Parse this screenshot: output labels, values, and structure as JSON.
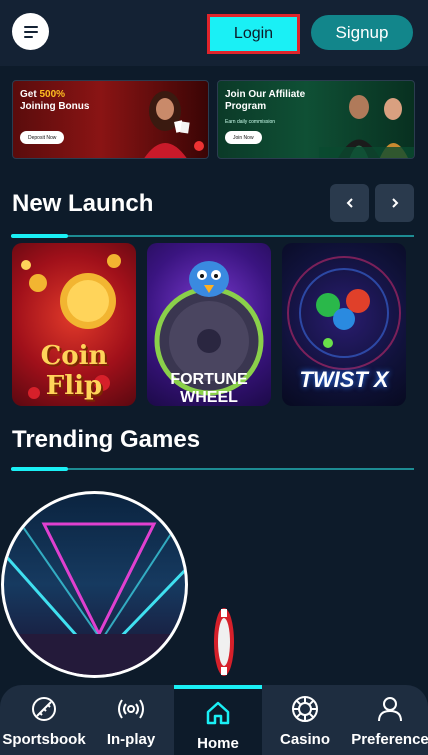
{
  "header": {
    "login_label": "Login",
    "signup_label": "Signup"
  },
  "banners": [
    {
      "title_prefix": "Get ",
      "title_highlight": "500%",
      "title_suffix": "Joining Bonus",
      "button_label": "Deposit Now"
    },
    {
      "title": "Join Our Affiliate Program",
      "subtitle": "Earn daily commission",
      "button_label": "Join Now"
    }
  ],
  "new_launch": {
    "title": "New Launch",
    "games": [
      {
        "label": "Coin Flip"
      },
      {
        "label": "FORTUNE WHEEL"
      },
      {
        "label": "TWIST X"
      }
    ]
  },
  "trending": {
    "title": "Trending Games"
  },
  "bottom_nav": [
    {
      "label": "Sportsbook",
      "icon": "sportsbook-icon"
    },
    {
      "label": "In-play",
      "icon": "broadcast-icon"
    },
    {
      "label": "Home",
      "icon": "home-icon",
      "active": true
    },
    {
      "label": "Casino",
      "icon": "casino-chip-icon"
    },
    {
      "label": "Preference",
      "icon": "user-icon"
    }
  ],
  "colors": {
    "accent": "#1af0f5",
    "signup": "#12868b",
    "background": "#0d1b2a",
    "highlight_border": "#e0242b"
  }
}
